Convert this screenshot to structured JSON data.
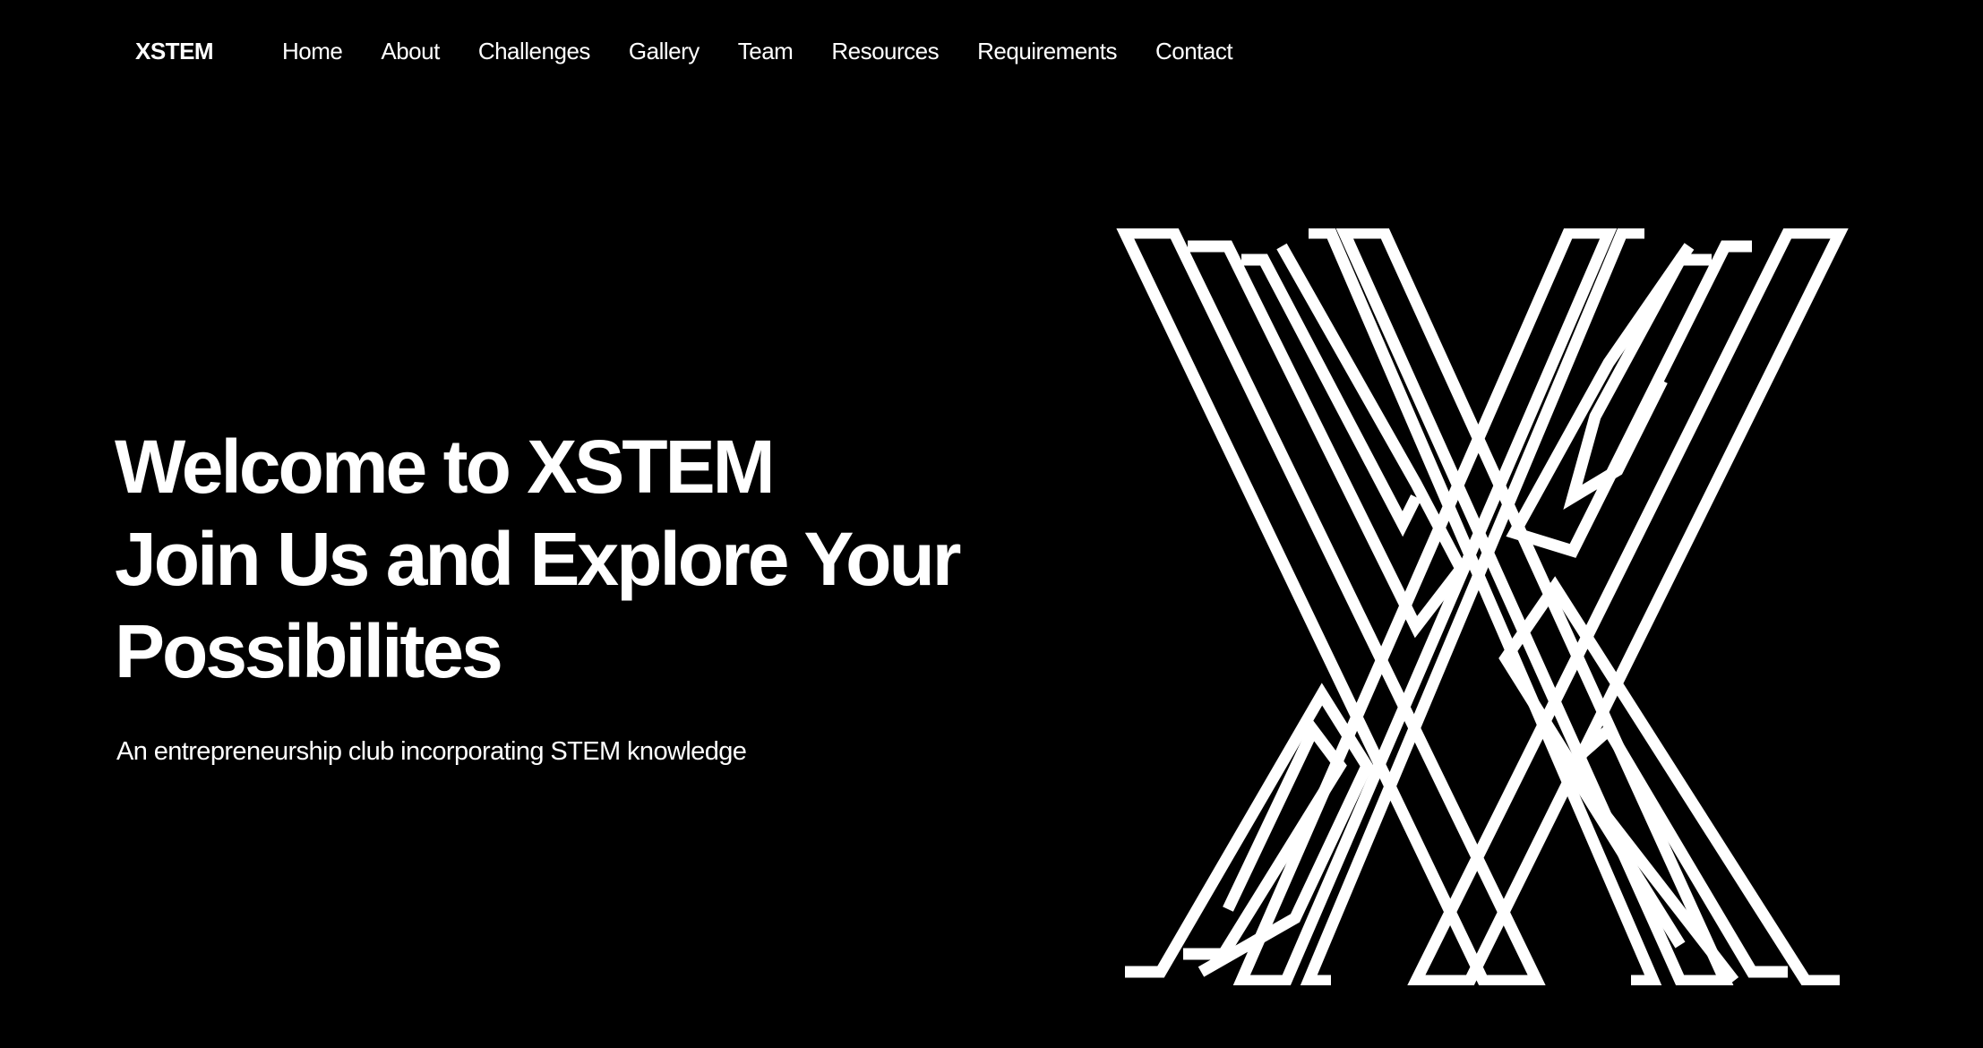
{
  "nav": {
    "brand": "XSTEM",
    "links": [
      {
        "label": "Home"
      },
      {
        "label": "About"
      },
      {
        "label": "Challenges"
      },
      {
        "label": "Gallery"
      },
      {
        "label": "Team"
      },
      {
        "label": "Resources"
      },
      {
        "label": "Requirements"
      },
      {
        "label": "Contact"
      }
    ]
  },
  "hero": {
    "title_lines": [
      "Welcome to XSTEM",
      "Join Us and Explore Your",
      "Possibilites"
    ],
    "subtitle": "An entrepreneurship club incorporating STEM knowledge"
  },
  "logo": {
    "icon": "x-maze-logo-icon",
    "color": "#ffffff"
  },
  "colors": {
    "background": "#000000",
    "text": "#ffffff"
  }
}
